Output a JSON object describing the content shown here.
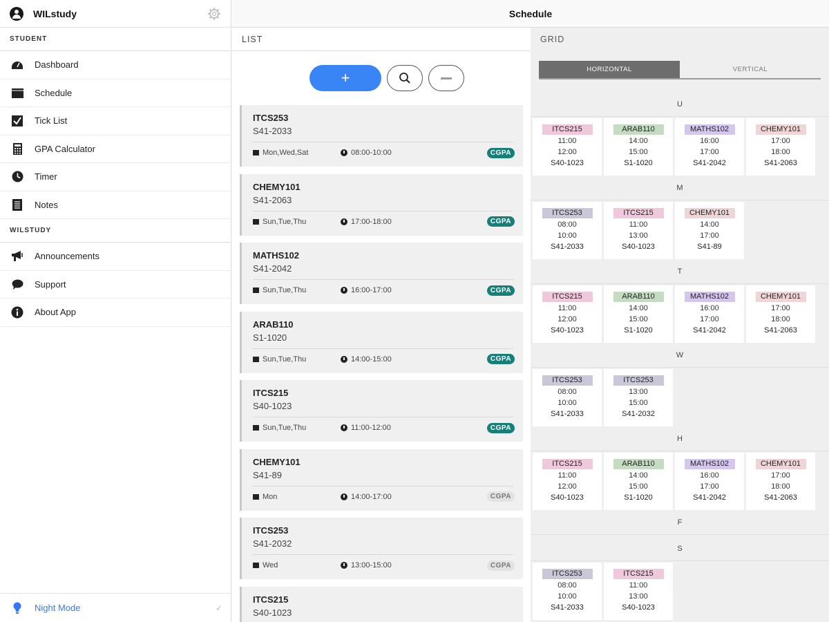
{
  "app": {
    "name": "WILstudy",
    "title": "Schedule"
  },
  "sidebar": {
    "student_header": "STUDENT",
    "student_items": [
      {
        "label": "Dashboard",
        "icon": "dashboard-icon"
      },
      {
        "label": "Schedule",
        "icon": "calendar-icon"
      },
      {
        "label": "Tick List",
        "icon": "checkbox-icon"
      },
      {
        "label": "GPA Calculator",
        "icon": "calculator-icon"
      },
      {
        "label": "Timer",
        "icon": "clock-icon"
      },
      {
        "label": "Notes",
        "icon": "notes-icon"
      }
    ],
    "wilstudy_header": "WILSTUDY",
    "wilstudy_items": [
      {
        "label": "Announcements",
        "icon": "megaphone-icon"
      },
      {
        "label": "Support",
        "icon": "chat-bubble-icon"
      },
      {
        "label": "About App",
        "icon": "info-icon"
      }
    ],
    "night_mode": {
      "label": "Night Mode",
      "checked": true
    }
  },
  "list": {
    "header": "LIST",
    "add_label": "+",
    "courses": [
      {
        "code": "ITCS253",
        "room": "S41-2033",
        "days": "Mon,Wed,Sat",
        "time": "08:00-10:00",
        "badge": "CGPA",
        "badge_on": true
      },
      {
        "code": "CHEMY101",
        "room": "S41-2063",
        "days": "Sun,Tue,Thu",
        "time": "17:00-18:00",
        "badge": "CGPA",
        "badge_on": true
      },
      {
        "code": "MATHS102",
        "room": "S41-2042",
        "days": "Sun,Tue,Thu",
        "time": "16:00-17:00",
        "badge": "CGPA",
        "badge_on": true
      },
      {
        "code": "ARAB110",
        "room": "S1-1020",
        "days": "Sun,Tue,Thu",
        "time": "14:00-15:00",
        "badge": "CGPA",
        "badge_on": true
      },
      {
        "code": "ITCS215",
        "room": "S40-1023",
        "days": "Sun,Tue,Thu",
        "time": "11:00-12:00",
        "badge": "CGPA",
        "badge_on": true
      },
      {
        "code": "CHEMY101",
        "room": "S41-89",
        "days": "Mon",
        "time": "14:00-17:00",
        "badge": "CGPA",
        "badge_on": false
      },
      {
        "code": "ITCS253",
        "room": "S41-2032",
        "days": "Wed",
        "time": "13:00-15:00",
        "badge": "CGPA",
        "badge_on": false
      },
      {
        "code": "ITCS215",
        "room": "S40-1023",
        "days": "",
        "time": "",
        "badge": "",
        "badge_on": false
      }
    ]
  },
  "grid": {
    "header": "GRID",
    "tabs": {
      "horizontal": "HORIZONTAL",
      "vertical": "VERTICAL",
      "active": "horizontal"
    },
    "course_colors": {
      "ITCS215": "#f0c8dc",
      "ARAB110": "#c4dcc2",
      "MATHS102": "#d4c6ec",
      "CHEMY101": "#efd4d8",
      "ITCS253": "#c8c8d8"
    },
    "days": [
      {
        "label": "U",
        "slots": [
          {
            "code": "ITCS215",
            "start": "11:00",
            "end": "12:00",
            "room": "S40-1023"
          },
          {
            "code": "ARAB110",
            "start": "14:00",
            "end": "15:00",
            "room": "S1-1020"
          },
          {
            "code": "MATHS102",
            "start": "16:00",
            "end": "17:00",
            "room": "S41-2042"
          },
          {
            "code": "CHEMY101",
            "start": "17:00",
            "end": "18:00",
            "room": "S41-2063"
          }
        ]
      },
      {
        "label": "M",
        "slots": [
          {
            "code": "ITCS253",
            "start": "08:00",
            "end": "10:00",
            "room": "S41-2033"
          },
          {
            "code": "ITCS215",
            "start": "11:00",
            "end": "13:00",
            "room": "S40-1023"
          },
          {
            "code": "CHEMY101",
            "start": "14:00",
            "end": "17:00",
            "room": "S41-89"
          }
        ]
      },
      {
        "label": "T",
        "slots": [
          {
            "code": "ITCS215",
            "start": "11:00",
            "end": "12:00",
            "room": "S40-1023"
          },
          {
            "code": "ARAB110",
            "start": "14:00",
            "end": "15:00",
            "room": "S1-1020"
          },
          {
            "code": "MATHS102",
            "start": "16:00",
            "end": "17:00",
            "room": "S41-2042"
          },
          {
            "code": "CHEMY101",
            "start": "17:00",
            "end": "18:00",
            "room": "S41-2063"
          }
        ]
      },
      {
        "label": "W",
        "slots": [
          {
            "code": "ITCS253",
            "start": "08:00",
            "end": "10:00",
            "room": "S41-2033"
          },
          {
            "code": "ITCS253",
            "start": "13:00",
            "end": "15:00",
            "room": "S41-2032"
          }
        ]
      },
      {
        "label": "H",
        "slots": [
          {
            "code": "ITCS215",
            "start": "11:00",
            "end": "12:00",
            "room": "S40-1023"
          },
          {
            "code": "ARAB110",
            "start": "14:00",
            "end": "15:00",
            "room": "S1-1020"
          },
          {
            "code": "MATHS102",
            "start": "16:00",
            "end": "17:00",
            "room": "S41-2042"
          },
          {
            "code": "CHEMY101",
            "start": "17:00",
            "end": "18:00",
            "room": "S41-2063"
          }
        ]
      },
      {
        "label": "F",
        "slots": []
      },
      {
        "label": "S",
        "slots": [
          {
            "code": "ITCS253",
            "start": "08:00",
            "end": "10:00",
            "room": "S41-2033"
          },
          {
            "code": "ITCS215",
            "start": "11:00",
            "end": "13:00",
            "room": "S40-1023"
          }
        ]
      }
    ]
  }
}
